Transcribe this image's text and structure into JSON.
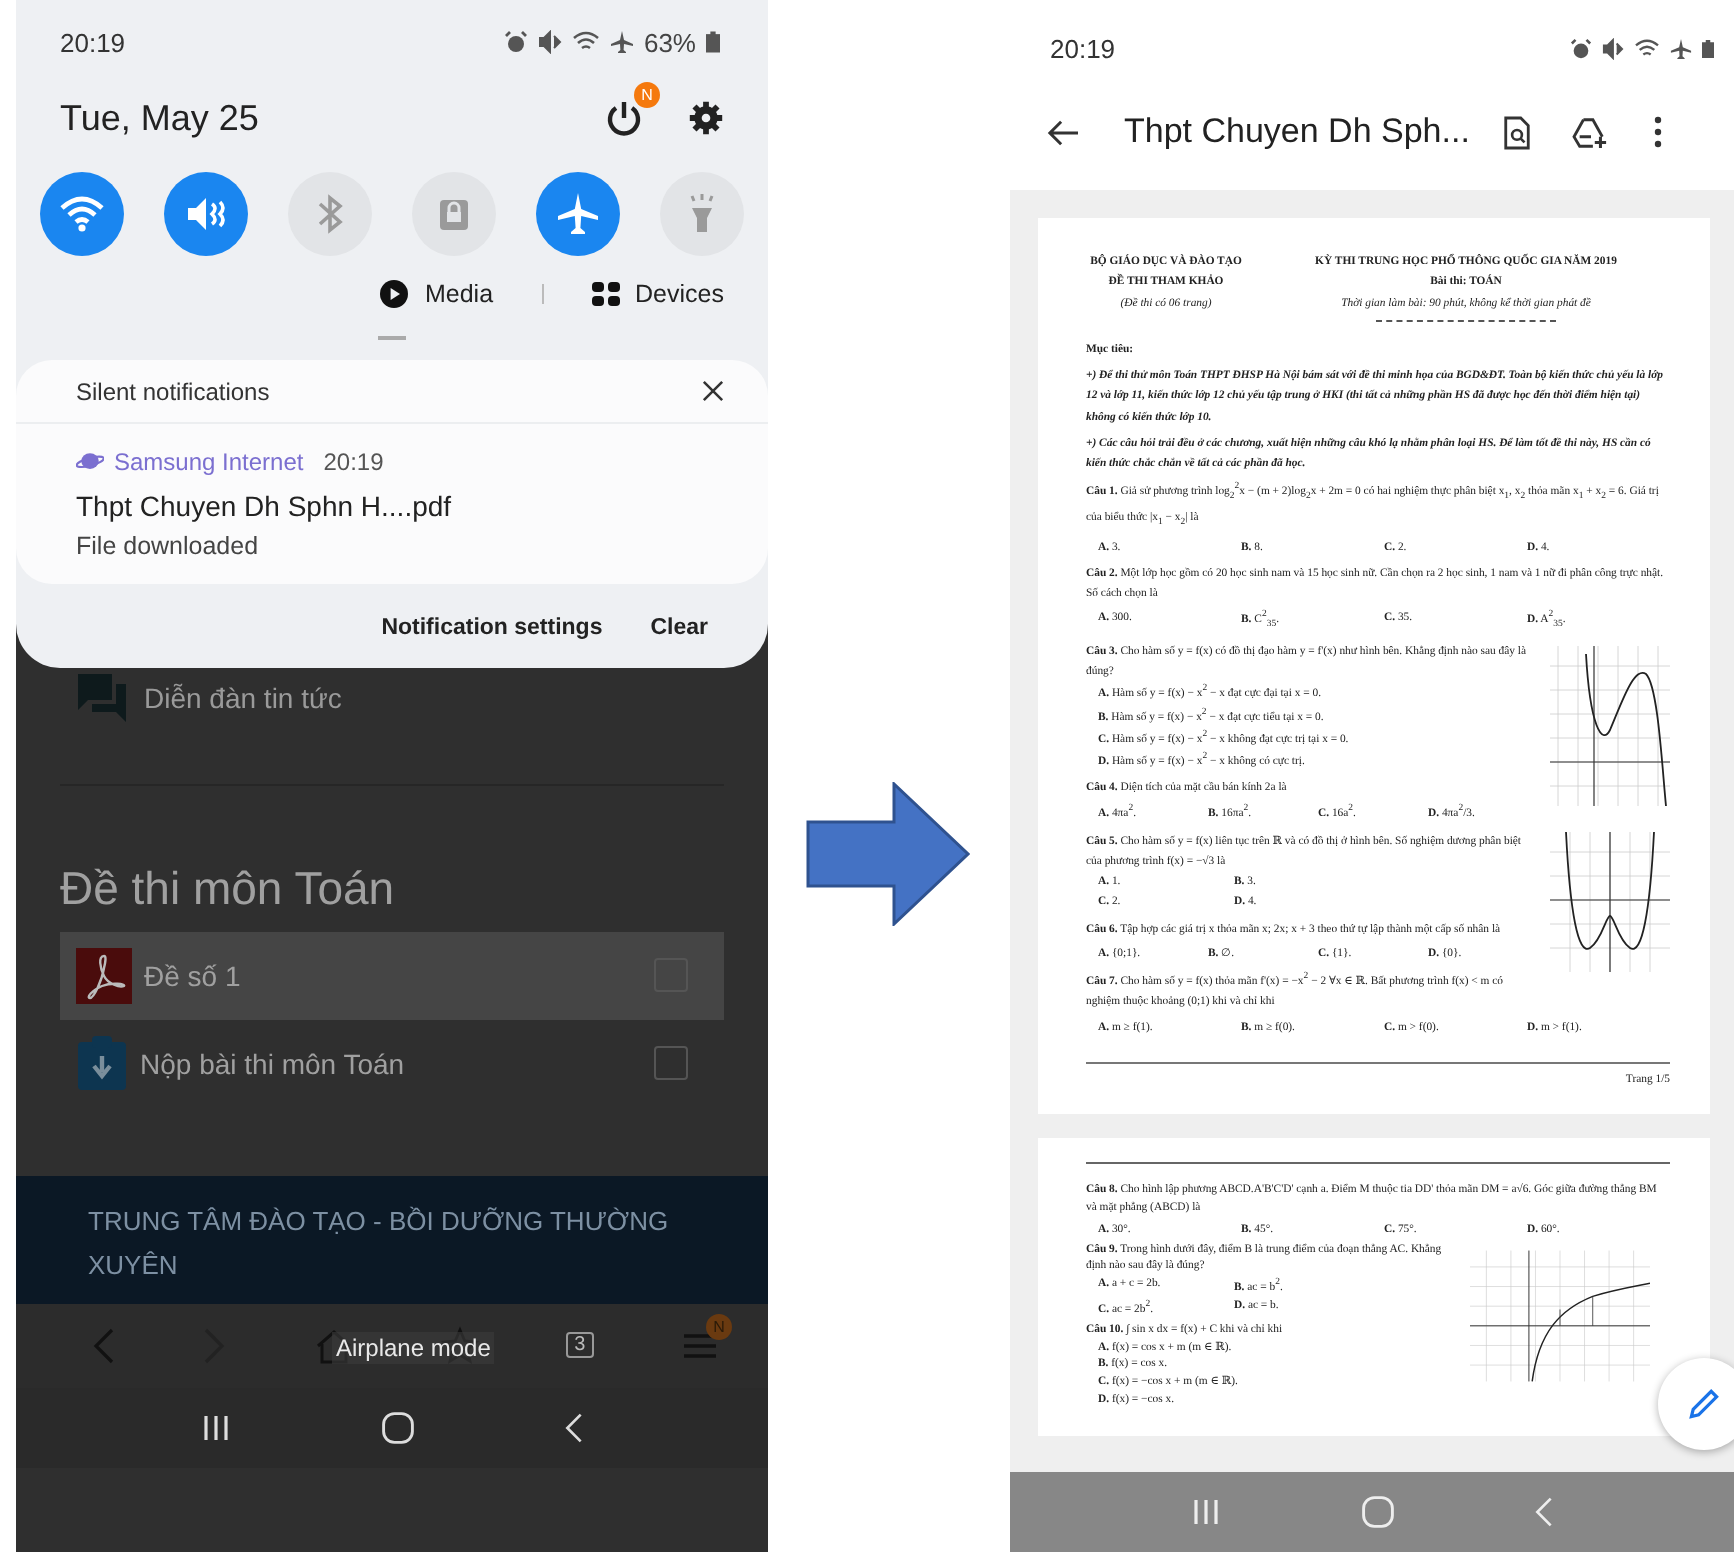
{
  "left_phone": {
    "status_bar": {
      "time": "20:19",
      "battery": "63%"
    },
    "date": "Tue, May 25",
    "update_badge": "N",
    "quick_toggles": [
      {
        "kind": "wifi",
        "on": true
      },
      {
        "kind": "mute",
        "on": true
      },
      {
        "kind": "bluetooth",
        "on": false
      },
      {
        "kind": "lock",
        "on": false
      },
      {
        "kind": "airplane",
        "on": true
      },
      {
        "kind": "flashlight",
        "on": false
      }
    ],
    "media_button": "Media",
    "devices_button": "Devices",
    "notification_group": {
      "title": "Silent notifications",
      "app": "Samsung Internet",
      "time": "20:19",
      "file": "Thpt Chuyen Dh Sphn H....pdf",
      "message": "File downloaded"
    },
    "actions": [
      "Notification settings",
      "Clear"
    ],
    "page": {
      "forum_link": "Diễn đàn tin tức",
      "section_title": "Đề thi môn Toán",
      "items": [
        {
          "kind": "pdf",
          "label": "Đề số 1",
          "checked": false,
          "highlighted": true
        },
        {
          "kind": "assignment",
          "label": "Nộp bài thi môn Toán",
          "checked": false,
          "highlighted": false
        }
      ],
      "footer": "TRUNG TÂM ĐÀO TẠO - BỒI DƯỠNG THƯỜNG XUYÊN"
    },
    "browser_bar": {
      "tab_count": "3",
      "menu_badge": "N"
    },
    "toast": "Airplane mode"
  },
  "right_phone": {
    "status_bar": {
      "time": "20:19"
    },
    "app_bar": {
      "title": "Thpt Chuyen Dh Sph..."
    },
    "pages": [
      {
        "header_left": [
          {
            "kind": "bold",
            "text": "BỘ GIÁO DỤC VÀ ĐÀO TẠO"
          },
          {
            "kind": "bold",
            "text": "ĐỀ THI THAM KHẢO"
          },
          {
            "kind": "italic",
            "text": "(Đề thi có 06 trang)"
          }
        ],
        "header_right": [
          {
            "kind": "bold",
            "text": "KỲ THI TRUNG HỌC PHỔ THÔNG QUỐC GIA NĂM 2019"
          },
          {
            "kind": "bold",
            "text": "Bài thi: TOÁN"
          },
          {
            "kind": "italic",
            "text": "Thời gian làm bài: 90 phút, không kể thời gian phát đề"
          }
        ],
        "blocks": [
          {
            "kind": "heading",
            "text": "Mục tiêu:"
          },
          {
            "kind": "paragraph",
            "text": "+) Để thi thử môn Toán THPT ĐHSP Hà Nội bám sát với đề thi minh họa của BGD&ĐT. Toàn bộ kiến thức chủ yếu là lớp 12 và lớp 11, kiến thức lớp 12 chủ yếu tập trung ở HKI (thi tất cả những phần HS đã được học đến thời điểm hiện tại) không có kiến thức lớp 10."
          },
          {
            "kind": "paragraph",
            "text": "+) Các câu hỏi trải đều ở các chương, xuất hiện những câu khó lạ nhằm phân loại HS. Để làm tốt đề thi này, HS cần có kiến thức chắc chắn về tất cả các phần đã học."
          },
          {
            "kind": "question",
            "text": "**Câu 1.** Giả sử phương trình log$_{2}$$^{2}$x − (m + 2)log$_{2}$x + 2m = 0 có hai nghiệm thực phân biệt x$_{1}$, x$_{2}$ thỏa mãn x$_{1}$ + x$_{2}$ = 6. Giá trị của biểu thức |x$_{1}$ − x$_{2}$| là",
            "option_rows": [
              [
                "**A.** 3.",
                "**B.** 8.",
                "**C.** 2.",
                "**D.** 4."
              ]
            ]
          },
          {
            "kind": "question",
            "text": "**Câu 2.** Một lớp học gồm có 20 học sinh nam và 15 học sinh nữ. Cần chọn ra 2 học sinh, 1 nam và 1 nữ đi phân công trực nhật. Số cách chọn là",
            "option_rows": [
              [
                "**A.** 300.",
                "**B.** C$^{2}$$_{35}$.",
                "**C.** 35.",
                "**D.** A$^{2}$$_{35}$."
              ]
            ]
          },
          {
            "kind": "question",
            "figure": {
              "kind": "cubic"
            },
            "text": "**Câu 3.** Cho hàm số y = f(x) có đồ thị đạo hàm y = f'(x) như hình bên. Khẳng định nào sau đây là đúng?",
            "option_rows": [
              [
                "**A.** Hàm số y = f(x) − x$^{2}$ − x đạt cực đại tại x = 0."
              ],
              [
                "**B.** Hàm số y = f(x) − x$^{2}$ − x đạt cực tiểu tại x = 0."
              ],
              [
                "**C.** Hàm số y = f(x) − x$^{2}$ − x không đạt cực trị tại x = 0."
              ],
              [
                "**D.** Hàm số y = f(x) − x$^{2}$ − x không có cực trị."
              ]
            ]
          },
          {
            "kind": "question",
            "text": "**Câu 4.** Diện tích của mặt cầu bán kính 2a là",
            "option_rows": [
              [
                "**A.** 4πa$^{2}$.",
                "**B.** 16πa$^{2}$.",
                "**C.** 16a$^{2}$.",
                "**D.** 4πa$^{2}$/3."
              ]
            ]
          },
          {
            "kind": "question",
            "figure": {
              "kind": "quartic"
            },
            "text": "**Câu 5.** Cho hàm số y = f(x) liên tục trên ℝ và có đồ thị ở hình bên. Số nghiệm dương phân biệt của phương trình f(x) = −√3 là",
            "option_rows": [
              [
                "**A.** 1.",
                "**B.** 3."
              ],
              [
                "**C.** 2.",
                "**D.** 4."
              ]
            ]
          },
          {
            "kind": "question",
            "text": "**Câu 6.** Tập hợp các giá trị x thỏa mãn x; 2x; x + 3 theo thứ tự lập thành một cấp số nhân là",
            "option_rows": [
              [
                "**A.** {0;1}.",
                "**B.** ∅.",
                "**C.** {1}.",
                "**D.** {0}."
              ]
            ]
          },
          {
            "kind": "question",
            "text": "**Câu 7.** Cho hàm số y = f(x) thỏa mãn f'(x) = −x$^{2}$ − 2 ∀x ∈ ℝ. Bất phương trình f(x) < m có nghiệm thuộc khoảng (0;1) khi và chỉ khi",
            "option_rows": [
              [
                "**A.** m ≥ f(1).",
                "**B.** m ≥ f(0).",
                "**C.** m > f(0).",
                "**D.** m > f(1)."
              ]
            ]
          }
        ],
        "footer": "Trang 1/5"
      },
      {
        "blocks": [
          {
            "kind": "question",
            "text": "**Câu 8.** Cho hình lập phương ABCD.A'B'C'D' cạnh a. Điểm M thuộc tia DD' thỏa mãn DM = a√6. Góc giữa đường thẳng BM và mặt phẳng (ABCD) là",
            "option_rows": [
              [
                "**A.** 30°.",
                "**B.** 45°.",
                "**C.** 75°.",
                "**D.** 60°."
              ]
            ]
          },
          {
            "kind": "question",
            "figure": {
              "kind": "log"
            },
            "text": "**Câu 9.** Trong hình dưới đây, điểm B là trung điểm của đoạn thẳng AC. Khẳng định nào sau đây là đúng?",
            "option_rows": [
              [
                "**A.** a + c = 2b.",
                "**B.** ac = b$^{2}$."
              ],
              [
                "**C.** ac = 2b$^{2}$.",
                "**D.** ac = b."
              ]
            ]
          },
          {
            "kind": "question",
            "text": "**Câu 10.** ∫ sin x dx = f(x) + C khi và chỉ khi",
            "option_rows": [
              [
                "**A.** f(x) = cos x + m (m ∈ ℝ)."
              ],
              [
                "**B.** f(x) = cos x."
              ],
              [
                "**C.** f(x) = −cos x + m (m ∈ ℝ)."
              ],
              [
                "**D.** f(x) = −cos x."
              ]
            ]
          }
        ]
      }
    ]
  }
}
